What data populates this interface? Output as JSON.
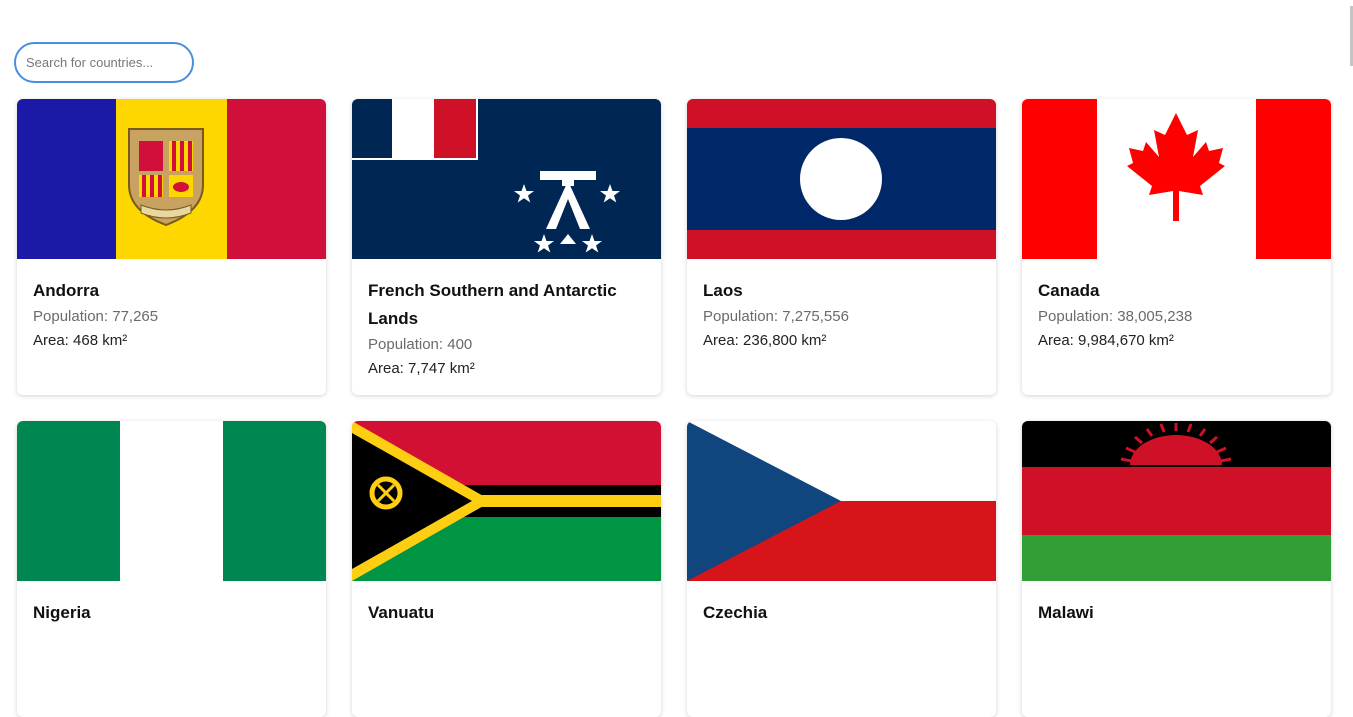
{
  "search": {
    "placeholder": "Search for countries..."
  },
  "countries": [
    {
      "name": "Andorra",
      "population": "Population: 77,265",
      "area": "Area: 468 km²",
      "flag": "andorra-flag"
    },
    {
      "name": "French Southern and Antarctic Lands",
      "population": "Population: 400",
      "area": "Area: 7,747 km²",
      "flag": "french-southern-lands-flag"
    },
    {
      "name": "Laos",
      "population": "Population: 7,275,556",
      "area": "Area: 236,800 km²",
      "flag": "laos-flag"
    },
    {
      "name": "Canada",
      "population": "Population: 38,005,238",
      "area": "Area: 9,984,670 km²",
      "flag": "canada-flag"
    },
    {
      "name": "Nigeria",
      "flag": "nigeria-flag"
    },
    {
      "name": "Vanuatu",
      "flag": "vanuatu-flag"
    },
    {
      "name": "Czechia",
      "flag": "czechia-flag"
    },
    {
      "name": "Malawi",
      "flag": "malawi-flag"
    }
  ],
  "colors": {
    "search_border": "#4a8ee0",
    "population_text": "#6b6b6b"
  }
}
